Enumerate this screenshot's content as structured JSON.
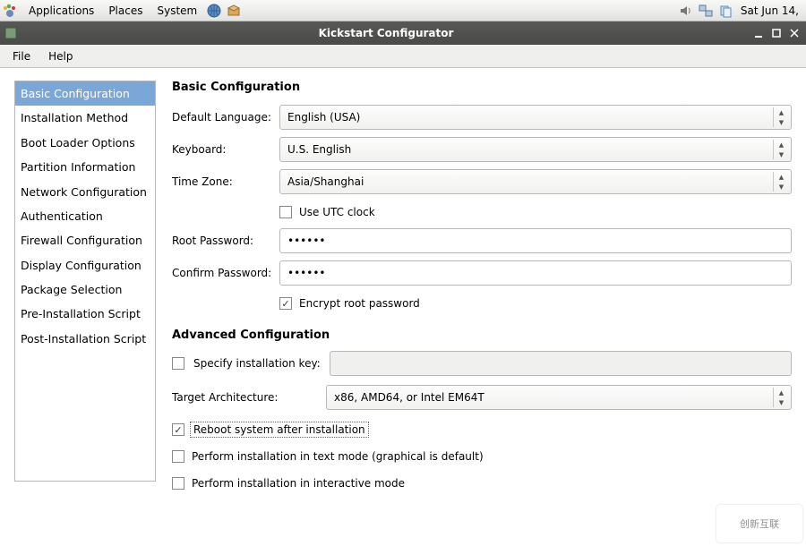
{
  "panel": {
    "applications": "Applications",
    "places": "Places",
    "system": "System",
    "clock": "Sat Jun 14,"
  },
  "window": {
    "title": "Kickstart Configurator"
  },
  "menubar": {
    "file": "File",
    "help": "Help"
  },
  "sidebar": {
    "items": [
      "Basic Configuration",
      "Installation Method",
      "Boot Loader Options",
      "Partition Information",
      "Network Configuration",
      "Authentication",
      "Firewall Configuration",
      "Display Configuration",
      "Package Selection",
      "Pre-Installation Script",
      "Post-Installation Script"
    ]
  },
  "basic": {
    "title": "Basic Configuration",
    "labels": {
      "default_language": "Default Language:",
      "keyboard": "Keyboard:",
      "time_zone": "Time Zone:",
      "root_password": "Root Password:",
      "confirm_password": "Confirm Password:"
    },
    "values": {
      "default_language": "English (USA)",
      "keyboard": "U.S. English",
      "time_zone": "Asia/Shanghai",
      "root_password": "••••••",
      "confirm_password": "••••••"
    },
    "use_utc": {
      "label": "Use UTC clock",
      "checked": false
    },
    "encrypt_root": {
      "label": "Encrypt root password",
      "checked": true
    }
  },
  "advanced": {
    "title": "Advanced Configuration",
    "specify_key": {
      "label": "Specify installation key:",
      "checked": false,
      "value": ""
    },
    "target_arch": {
      "label": "Target Architecture:",
      "value": "x86, AMD64, or Intel EM64T"
    },
    "reboot": {
      "label": "Reboot system after installation",
      "checked": true
    },
    "text_mode": {
      "label": "Perform installation in text mode (graphical is default)",
      "checked": false
    },
    "interactive": {
      "label": "Perform installation in interactive mode",
      "checked": false
    }
  },
  "watermark": "创新互联"
}
